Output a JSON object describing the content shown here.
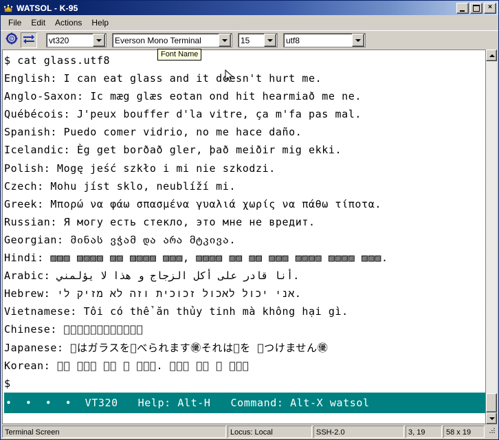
{
  "window": {
    "title": "WATSOL - K-95",
    "icon": "crown-icon",
    "controls": {
      "minimize": "minimize-button",
      "maximize": "maximize-button",
      "close": "×"
    }
  },
  "menu": {
    "items": [
      {
        "label": "File"
      },
      {
        "label": "Edit"
      },
      {
        "label": "Actions"
      },
      {
        "label": "Help"
      }
    ]
  },
  "toolbar": {
    "buttons": [
      {
        "name": "connection-settings-icon"
      },
      {
        "name": "transfer-arrows-icon",
        "pressed": true
      }
    ],
    "terminal_type": {
      "value": "vt320"
    },
    "font_name": {
      "value": "Everson Mono Terminal"
    },
    "font_size": {
      "value": "15"
    },
    "encoding": {
      "value": "utf8"
    },
    "tooltip": "Font Name"
  },
  "terminal": {
    "lines": [
      "$ cat glass.utf8",
      "English: I can eat glass and it doesn't hurt me.",
      "Anglo-Saxon: Ic mæg glæs eotan ond hit hearmiað me ne.",
      "Québécois: J'peux bouffer d'la vitre, ça m'fa pas mal.",
      "Spanish: Puedo comer vidrio, no me hace daño.",
      "Icelandic: Èg get borðað gler, það meiðir mig ekki.",
      "Polish: Mogę jeść szkło i mi nie szkodzi.",
      "Czech: Mohu jíst sklo, neublíží mi.",
      "Greek: Μπορώ να φάω σπασμένα γυαλιά χωρίς να πάθω τίποτα.",
      "Russian: Я могу есть стекло, это мне не вредит.",
      "Georgian: მინას ვჭამ და არა მტკივა.",
      "Hindi: ▨▨▨ ▨▨▨▨ ▨▨ ▨▨▨▨ ▨▨▨, ▨▨▨▨ ▨▨ ▨▨ ▨▨▨ ▨▨▨▨ ▨▨▨▨ ▨▨▨.",
      "Arabic: أنا قادر على أكل الزجاج و هذا لا يؤلمني.",
      "Hebrew: אני יכול לאכול זכוכית וזה לא מזיק לי.",
      "Vietnamese: Tôi có thể ăn thủy tinh mà không hại gì.",
      "Chinese: 􀀀􀀀􀀀􀀀􀀀􀀀􀀀􀀀􀀀􀀀􀀀㊝",
      "Japanese: 􀀀はガラスを􀀀べられます㊝それは􀀀を 􀀀つけません㊝",
      "Korean: 􀀀􀀀 􀀀􀀀􀀀 􀀀􀀀 􀀀 􀀀􀀀􀀀. 􀀀􀀀􀀀 􀀀􀀀 􀀀 􀀀􀀀􀀀",
      "$"
    ],
    "status_line": "•  •  •  •  VT320   Help: Alt-H   Command: Alt-X watsol"
  },
  "scrollbar": {
    "up": "scroll-up-arrow",
    "down": "scroll-down-arrow"
  },
  "statusbar": {
    "message": "Terminal Screen",
    "locus": "Locus: Local",
    "protocol": "SSH-2.0",
    "position": "3, 19",
    "dimensions": "58 x 19"
  },
  "colors": {
    "title_start": "#0a246a",
    "status_line_bg": "#008080",
    "face": "#d4d0c8",
    "terminal_bg": "#ffffff",
    "tooltip_bg": "#ffffe1"
  }
}
